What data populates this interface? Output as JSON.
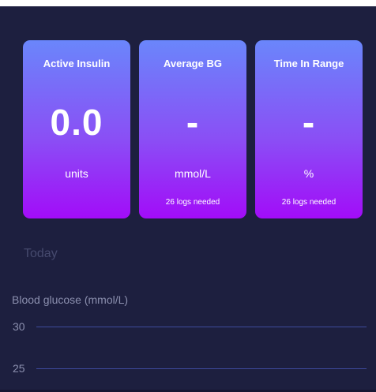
{
  "cards": [
    {
      "title": "Active Insulin",
      "value": "0.0",
      "unit": "units",
      "note": ""
    },
    {
      "title": "Average BG",
      "value": "-",
      "unit": "mmol/L",
      "note": "26 logs needed"
    },
    {
      "title": "Time In Range",
      "value": "-",
      "unit": "%",
      "note": "26 logs needed"
    }
  ],
  "section_label": "Today",
  "chart": {
    "ylabel": "Blood glucose (mmol/L)",
    "y_ticks": [
      "30",
      "25"
    ]
  },
  "colors": {
    "background": "#1d1f3f",
    "card_gradient_top": "#6a86fb",
    "card_gradient_bottom": "#a20cf8",
    "grid_line": "#3d4a9c",
    "muted_text": "#8b8fae"
  }
}
